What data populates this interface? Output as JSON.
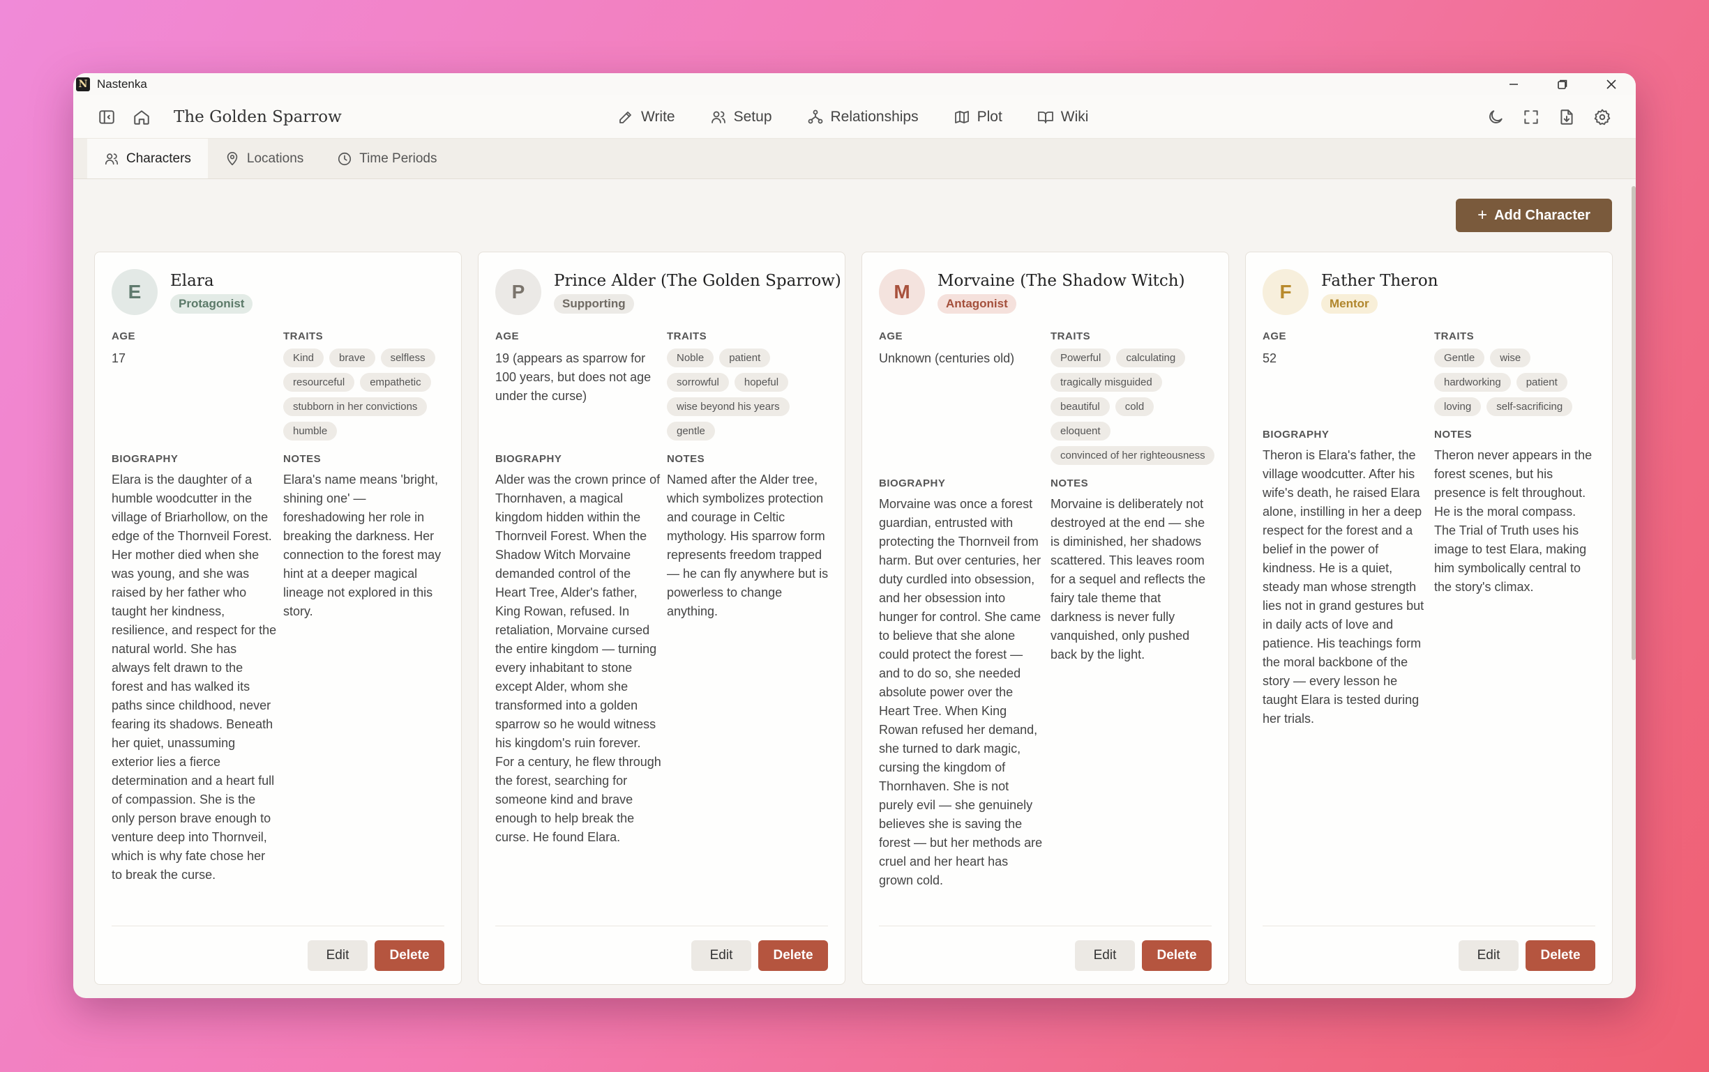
{
  "window": {
    "app_name": "Nastenka",
    "logo_letter": "N"
  },
  "header": {
    "project_title": "The Golden Sparrow",
    "nav": [
      {
        "label": "Write",
        "icon": "pencil-icon"
      },
      {
        "label": "Setup",
        "icon": "users-icon"
      },
      {
        "label": "Relationships",
        "icon": "network-icon"
      },
      {
        "label": "Plot",
        "icon": "map-icon"
      },
      {
        "label": "Wiki",
        "icon": "book-open-icon"
      }
    ]
  },
  "subtabs": [
    {
      "label": "Characters",
      "icon": "users-icon",
      "active": true
    },
    {
      "label": "Locations",
      "icon": "map-pin-icon",
      "active": false
    },
    {
      "label": "Time Periods",
      "icon": "clock-icon",
      "active": false
    }
  ],
  "toolbar": {
    "add_label": "Add Character"
  },
  "labels": {
    "age": "AGE",
    "traits": "TRAITS",
    "biography": "BIOGRAPHY",
    "notes": "NOTES",
    "edit": "Edit",
    "delete": "Delete"
  },
  "characters": [
    {
      "initial": "E",
      "name": "Elara",
      "role": "Protagonist",
      "avatar_bg": "#e3e9e6",
      "avatar_fg": "#5f7a6e",
      "badge_bg": "#e3ebe6",
      "badge_fg": "#5c7a69",
      "age": "17",
      "traits": [
        "Kind",
        "brave",
        "selfless",
        "resourceful",
        "empathetic",
        "stubborn in her convictions",
        "humble"
      ],
      "biography": "Elara is the daughter of a humble woodcutter in the village of Briarhollow, on the edge of the Thornveil Forest. Her mother died when she was young, and she was raised by her father who taught her kindness, resilience, and respect for the natural world. She has always felt drawn to the forest and has walked its paths since childhood, never fearing its shadows. Beneath her quiet, unassuming exterior lies a fierce determination and a heart full of compassion. She is the only person brave enough to venture deep into Thornveil, which is why fate chose her to break the curse.",
      "notes": "Elara's name means 'bright, shining one' — foreshadowing her role in breaking the darkness. Her connection to the forest may hint at a deeper magical lineage not explored in this story."
    },
    {
      "initial": "P",
      "name": "Prince Alder (The Golden Sparrow)",
      "role": "Supporting",
      "avatar_bg": "#ebe9e6",
      "avatar_fg": "#7a746c",
      "badge_bg": "#eceae6",
      "badge_fg": "#6f6a63",
      "age": "19 (appears as sparrow for 100 years, but does not age under the curse)",
      "traits": [
        "Noble",
        "patient",
        "sorrowful",
        "hopeful",
        "wise beyond his years",
        "gentle"
      ],
      "biography": "Alder was the crown prince of Thornhaven, a magical kingdom hidden within the Thornveil Forest. When the Shadow Witch Morvaine demanded control of the Heart Tree, Alder's father, King Rowan, refused. In retaliation, Morvaine cursed the entire kingdom — turning every inhabitant to stone except Alder, whom she transformed into a golden sparrow so he would witness his kingdom's ruin forever. For a century, he flew through the forest, searching for someone kind and brave enough to help break the curse. He found Elara.",
      "notes": "Named after the Alder tree, which symbolizes protection and courage in Celtic mythology. His sparrow form represents freedom trapped — he can fly anywhere but is powerless to change anything."
    },
    {
      "initial": "M",
      "name": "Morvaine (The Shadow Witch)",
      "role": "Antagonist",
      "avatar_bg": "#f4e3de",
      "avatar_fg": "#a8513c",
      "badge_bg": "#f5e1dc",
      "badge_fg": "#a4503c",
      "age": "Unknown (centuries old)",
      "traits": [
        "Powerful",
        "calculating",
        "tragically misguided",
        "beautiful",
        "cold",
        "eloquent",
        "convinced of her righteousness"
      ],
      "biography": "Morvaine was once a forest guardian, entrusted with protecting the Thornveil from harm. But over centuries, her duty curdled into obsession, and her obsession into hunger for control. She came to believe that she alone could protect the forest — and to do so, she needed absolute power over the Heart Tree. When King Rowan refused her demand, she turned to dark magic, cursing the kingdom of Thornhaven. She is not purely evil — she genuinely believes she is saving the forest — but her methods are cruel and her heart has grown cold.",
      "notes": "Morvaine is deliberately not destroyed at the end — she is diminished, her shadows scattered. This leaves room for a sequel and reflects the fairy tale theme that darkness is never fully vanquished, only pushed back by the light."
    },
    {
      "initial": "F",
      "name": "Father Theron",
      "role": "Mentor",
      "avatar_bg": "#f7efdc",
      "avatar_fg": "#b88a2c",
      "badge_bg": "#f8efd8",
      "badge_fg": "#b0862c",
      "age": "52",
      "traits": [
        "Gentle",
        "wise",
        "hardworking",
        "patient",
        "loving",
        "self-sacrificing"
      ],
      "biography": "Theron is Elara's father, the village woodcutter. After his wife's death, he raised Elara alone, instilling in her a deep respect for the forest and a belief in the power of kindness. He is a quiet, steady man whose strength lies not in grand gestures but in daily acts of love and patience. His teachings form the moral backbone of the story — every lesson he taught Elara is tested during her trials.",
      "notes": "Theron never appears in the forest scenes, but his presence is felt throughout. He is the moral compass. The Trial of Truth uses his image to test Elara, making him symbolically central to the story's climax."
    }
  ]
}
